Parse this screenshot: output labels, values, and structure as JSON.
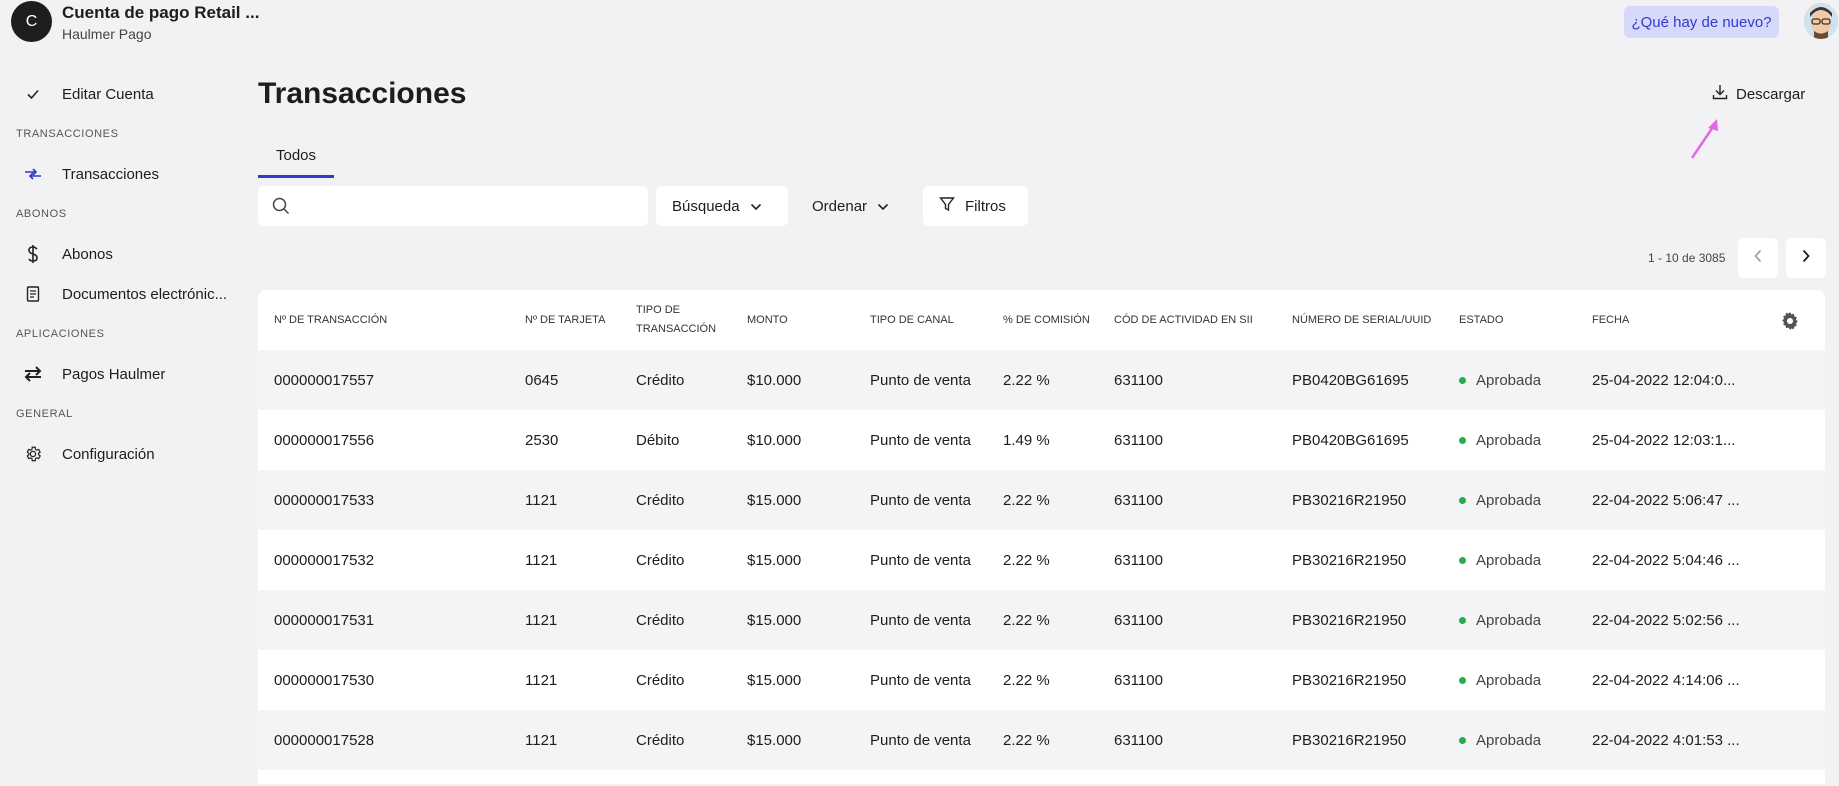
{
  "header": {
    "avatar_letter": "C",
    "account_name": "Cuenta de pago Retail ...",
    "account_sub": "Haulmer Pago",
    "whats_new": "¿Qué hay de nuevo?"
  },
  "sidebar": {
    "edit_account": "Editar Cuenta",
    "sections": {
      "transacciones": "TRANSACCIONES",
      "abonos": "ABONOS",
      "aplicaciones": "APLICACIONES",
      "general": "GENERAL"
    },
    "items": {
      "transacciones": "Transacciones",
      "abonos": "Abonos",
      "documentos": "Documentos electrónic...",
      "pagos": "Pagos Haulmer",
      "configuracion": "Configuración"
    }
  },
  "main": {
    "title": "Transacciones",
    "download_label": "Descargar",
    "tab_label": "Todos",
    "search_placeholder": "",
    "busqueda_label": "Búsqueda",
    "ordenar_label": "Ordenar",
    "filtros_label": "Filtros",
    "pager_text": "1 - 10 de 3085"
  },
  "colors": {
    "accent": "#2f3bc9",
    "status_ok": "#2fa84f",
    "annotation_arrow": "#e566e8"
  },
  "table": {
    "headers": {
      "tx_num": "Nº DE TRANSACCIÓN",
      "card_num": "Nº DE TARJETA",
      "tx_type_1": "TIPO DE",
      "tx_type_2": "TRANSACCIÓN",
      "amount": "MONTO",
      "channel": "TIPO DE CANAL",
      "commission": "% DE COMISIÓN",
      "activity": "CÓD DE ACTIVIDAD EN SII",
      "serial": "NÚMERO DE SERIAL/UUID",
      "status": "ESTADO",
      "date": "FECHA"
    },
    "rows": [
      {
        "tx": "000000017557",
        "card": "0645",
        "type": "Crédito",
        "amount": "$10.000",
        "channel": "Punto de venta",
        "commission": "2.22 %",
        "activity": "631100",
        "serial": "PB0420BG61695",
        "status": "Aprobada",
        "date": "25-04-2022 12:04:0..."
      },
      {
        "tx": "000000017556",
        "card": "2530",
        "type": "Débito",
        "amount": "$10.000",
        "channel": "Punto de venta",
        "commission": "1.49 %",
        "activity": "631100",
        "serial": "PB0420BG61695",
        "status": "Aprobada",
        "date": "25-04-2022 12:03:1..."
      },
      {
        "tx": "000000017533",
        "card": "1121",
        "type": "Crédito",
        "amount": "$15.000",
        "channel": "Punto de venta",
        "commission": "2.22 %",
        "activity": "631100",
        "serial": "PB30216R21950",
        "status": "Aprobada",
        "date": "22-04-2022 5:06:47 ..."
      },
      {
        "tx": "000000017532",
        "card": "1121",
        "type": "Crédito",
        "amount": "$15.000",
        "channel": "Punto de venta",
        "commission": "2.22 %",
        "activity": "631100",
        "serial": "PB30216R21950",
        "status": "Aprobada",
        "date": "22-04-2022 5:04:46 ..."
      },
      {
        "tx": "000000017531",
        "card": "1121",
        "type": "Crédito",
        "amount": "$15.000",
        "channel": "Punto de venta",
        "commission": "2.22 %",
        "activity": "631100",
        "serial": "PB30216R21950",
        "status": "Aprobada",
        "date": "22-04-2022 5:02:56 ..."
      },
      {
        "tx": "000000017530",
        "card": "1121",
        "type": "Crédito",
        "amount": "$15.000",
        "channel": "Punto de venta",
        "commission": "2.22 %",
        "activity": "631100",
        "serial": "PB30216R21950",
        "status": "Aprobada",
        "date": "22-04-2022 4:14:06 ..."
      },
      {
        "tx": "000000017528",
        "card": "1121",
        "type": "Crédito",
        "amount": "$15.000",
        "channel": "Punto de venta",
        "commission": "2.22 %",
        "activity": "631100",
        "serial": "PB30216R21950",
        "status": "Aprobada",
        "date": "22-04-2022 4:01:53 ..."
      }
    ]
  }
}
